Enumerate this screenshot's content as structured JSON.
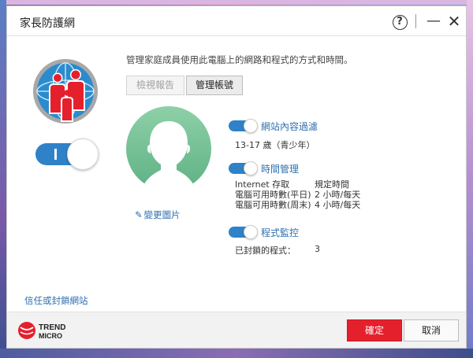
{
  "window": {
    "title": "家長防護網",
    "help_label": "?",
    "minimize_label": "—",
    "close_label": "✕"
  },
  "main": {
    "description": "管理家庭成員使用此電腦上的網路和程式的方式和時間。",
    "view_report_label": "檢視報告",
    "manage_accounts_label": "管理帳號",
    "change_picture_label": "變更圖片",
    "enabled": true
  },
  "sections": {
    "web_filter": {
      "label": "網站內容過濾",
      "enabled": true,
      "age_group": "13-17 歲（青少年）"
    },
    "time_management": {
      "label": "時間管理",
      "enabled": true,
      "rows": [
        {
          "key": "Internet 存取",
          "value": "規定時間"
        },
        {
          "key": "電腦可用時數(平日)",
          "value": "2 小時/每天"
        },
        {
          "key": "電腦可用時數(周末)",
          "value": "4 小時/每天"
        }
      ]
    },
    "program_control": {
      "label": "程式監控",
      "enabled": true,
      "blocked_label": "已封鎖的程式：",
      "blocked_count": "3"
    }
  },
  "footer": {
    "trust_block_link": "信任或封鎖網站",
    "brand_line1": "TREND",
    "brand_line2": "MICRO",
    "ok_label": "確定",
    "cancel_label": "取消"
  },
  "colors": {
    "accent_blue": "#2f82c8",
    "link_blue": "#2f6fb0",
    "ok_red": "#e5202d",
    "avatar_green": "#7cc49a"
  },
  "icons": {
    "family": "family-globe-icon",
    "avatar": "person-silhouette-icon",
    "edit": "pencil-icon"
  }
}
